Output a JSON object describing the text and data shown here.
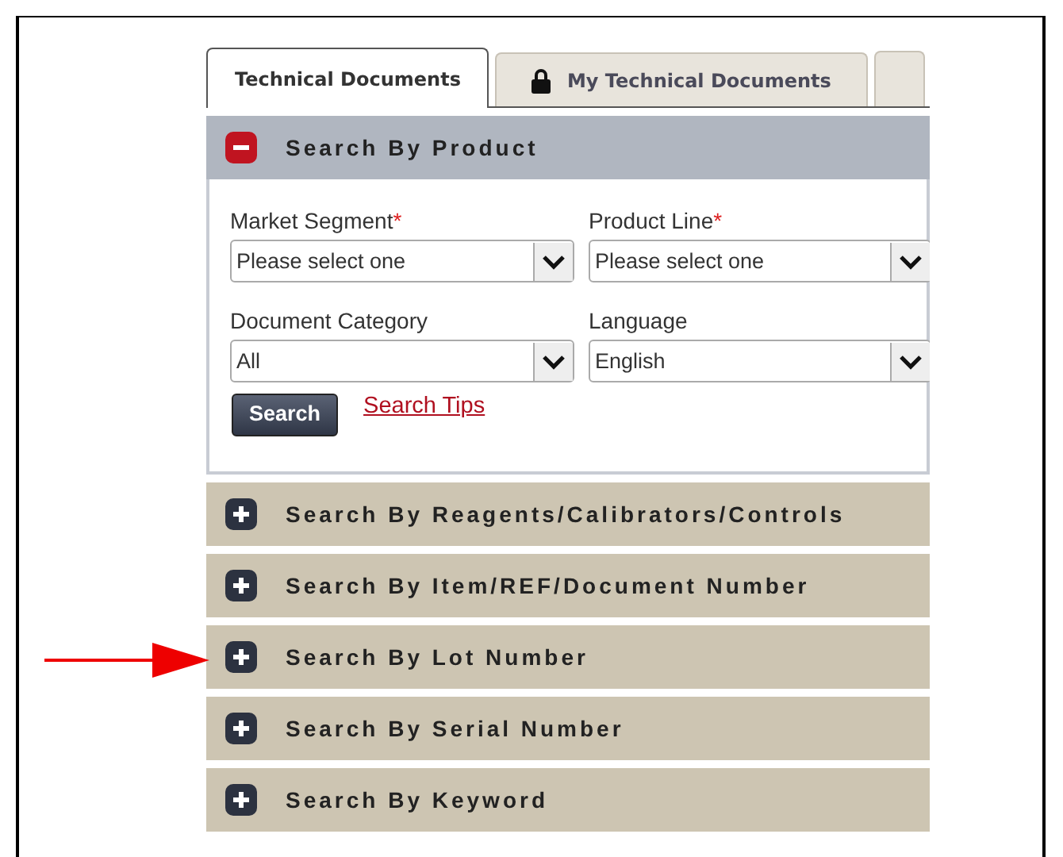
{
  "tabs": [
    {
      "label": "Technical Documents",
      "selected": true,
      "locked": false
    },
    {
      "label": "My Technical Documents",
      "selected": false,
      "locked": true
    }
  ],
  "sections": [
    {
      "title": "Search By Product",
      "expanded": true,
      "fields": [
        {
          "label": "Market Segment",
          "required": true,
          "value": "Please select one"
        },
        {
          "label": "Product Line",
          "required": true,
          "value": "Please select one"
        },
        {
          "label": "Document Category",
          "required": false,
          "value": "All"
        },
        {
          "label": "Language",
          "required": false,
          "value": "English"
        }
      ],
      "required_mark": "*",
      "button": "Search",
      "link": "Search Tips"
    },
    {
      "title": "Search By Reagents/Calibrators/Controls",
      "expanded": false
    },
    {
      "title": "Search By Item/REF/Document Number",
      "expanded": false
    },
    {
      "title": "Search By Lot Number",
      "expanded": false,
      "pointed": true
    },
    {
      "title": "Search By Serial Number",
      "expanded": false
    },
    {
      "title": "Search By Keyword",
      "expanded": false
    }
  ]
}
